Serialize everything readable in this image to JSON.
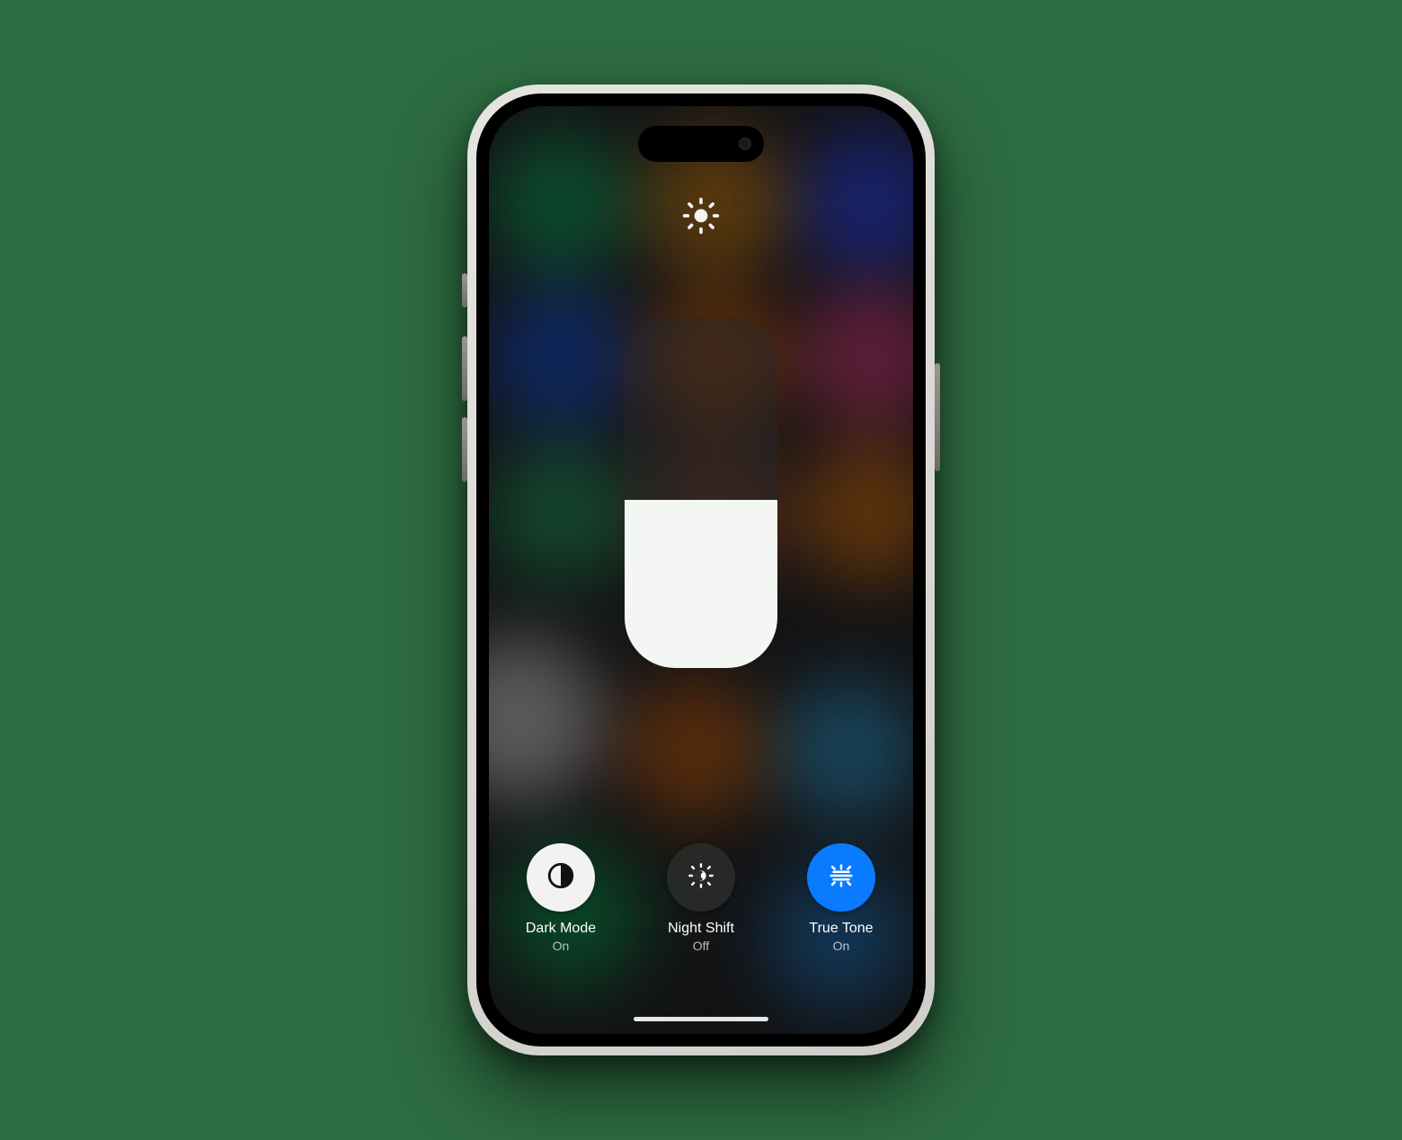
{
  "brightness": {
    "level_percent": 48
  },
  "controls": [
    {
      "id": "dark-mode",
      "title": "Dark Mode",
      "status": "On",
      "style": "white",
      "icon": "dark-mode-icon"
    },
    {
      "id": "night-shift",
      "title": "Night Shift",
      "status": "Off",
      "style": "dark",
      "icon": "night-shift-icon"
    },
    {
      "id": "true-tone",
      "title": "True Tone",
      "status": "On",
      "style": "blue",
      "icon": "true-tone-icon"
    }
  ]
}
